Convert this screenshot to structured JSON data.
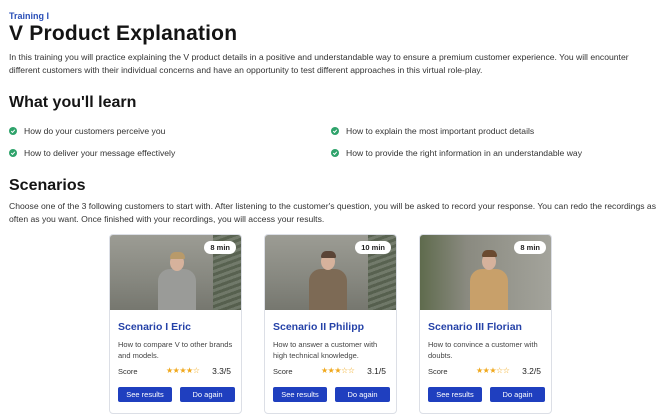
{
  "header": {
    "breadcrumb": "Training I",
    "title": "V Product Explanation",
    "intro": "In this training you will practice explaining the V product details in a positive and understandable way to ensure a premium customer experience. You will encounter different customers with their individual concerns and have an opportunity to test different approaches in this virtual role-play."
  },
  "learn": {
    "title": "What you'll learn",
    "items": [
      "How do your customers perceive you",
      "How to explain the most important product details",
      "How to deliver your message effectively",
      "How to provide the right information in an understandable way"
    ]
  },
  "scenarios": {
    "title": "Scenarios",
    "description": "Choose one of the 3 following customers to start with. After listening to the customer's question, you will be asked to record your response. You can redo the recordings as often as you want. Once finished with your recordings, you will access your results.",
    "cards": [
      {
        "duration": "8 min",
        "title": "Scenario I Eric",
        "text": "How to compare V to other brands and models.",
        "score_label": "Score",
        "stars": "★★★★☆",
        "score": "3.3/5",
        "results_label": "See results",
        "again_label": "Do again"
      },
      {
        "duration": "10 min",
        "title": "Scenario II Philipp",
        "text": "How to answer a customer with high technical knowledge.",
        "score_label": "Score",
        "stars": "★★★☆☆",
        "score": "3.1/5",
        "results_label": "See results",
        "again_label": "Do again"
      },
      {
        "duration": "8 min",
        "title": "Scenario III Florian",
        "text": "How to convince a customer with doubts.",
        "score_label": "Score",
        "stars": "★★★☆☆",
        "score": "3.2/5",
        "results_label": "See results",
        "again_label": "Do again"
      }
    ]
  },
  "colors": {
    "accent": "#1f3fbf",
    "title_blue": "#2542a8",
    "check_green": "#2fa36b",
    "star": "#f0a81c"
  }
}
